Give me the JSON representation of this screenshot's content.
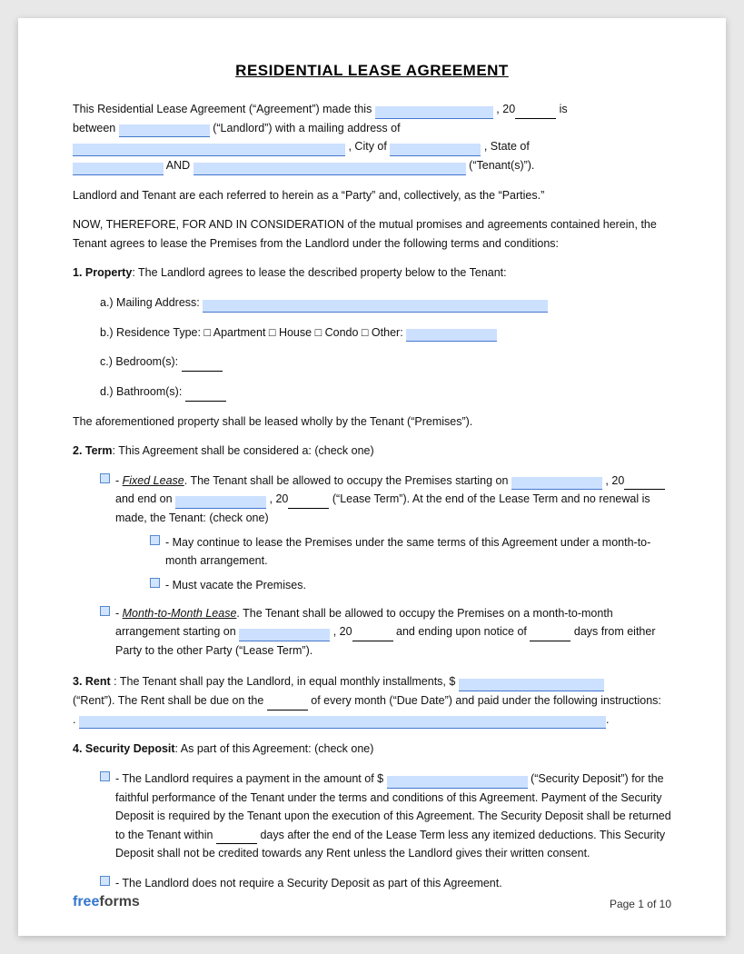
{
  "title": "RESIDENTIAL LEASE AGREEMENT",
  "intro": {
    "line1": "This Residential Lease Agreement (“Agreement”) made this",
    "line1b": ", 20",
    "line1c": "is",
    "line2": "between",
    "line2b": "(“Landlord”) with a mailing address of",
    "line3b": ", City of",
    "line3c": ", State of",
    "line4": "AND",
    "line4b": "(“Tenant(s)”)."
  },
  "parties_note": "Landlord and Tenant are each referred to herein as a “Party” and, collectively, as the “Parties.”",
  "now_therefore": "NOW, THEREFORE, FOR AND IN CONSIDERATION of the mutual promises and agreements contained herein, the Tenant agrees to lease the Premises from the Landlord under the following terms and conditions:",
  "section1": {
    "title": "1. Property",
    "intro": ": The Landlord agrees to lease the described property below to the Tenant:",
    "a_label": "a.)  Mailing Address:",
    "b_label": "b.)  Residence Type:",
    "b_options": [
      "□ Apartment",
      "□ House",
      "□ Condo",
      "□ Other:"
    ],
    "c_label": "c.)  Bedroom(s):",
    "d_label": "d.)  Bathroom(s):",
    "closing": "The aforementioned property shall be leased wholly by the Tenant (“Premises”)."
  },
  "section2": {
    "title": "2. Term",
    "intro": ": This Agreement shall be considered a: (check one)",
    "fixed_label": "- ",
    "fixed_title": "Fixed Lease",
    "fixed_text1": ". The Tenant shall be allowed to occupy the Premises starting on",
    "fixed_text2": ", 20",
    "fixed_text3": "and end on",
    "fixed_text4": ", 20",
    "fixed_text5": "(“Lease Term”). At the end of the Lease Term and no renewal is made, the Tenant: (check one)",
    "sub1": "- May continue to lease the Premises under the same terms of this Agreement under a month-to-month arrangement.",
    "sub2": "- Must vacate the Premises.",
    "mtm_label": "- ",
    "mtm_title": "Month-to-Month Lease",
    "mtm_text1": ". The Tenant shall be allowed to occupy the Premises on a month-to-month arrangement starting on",
    "mtm_text2": ", 20",
    "mtm_text3": "and ending upon notice of",
    "mtm_text4": "days from either Party to the other Party (“Lease Term”)."
  },
  "section3": {
    "title": "3. Rent",
    "text1": ": The Tenant shall pay the Landlord, in equal monthly installments, $",
    "text2": "(“Rent”). The Rent shall be due on the",
    "text3": "of every month (“Due Date”) and paid under the following instructions:",
    "text4": "."
  },
  "section4": {
    "title": "4. Security Deposit",
    "intro": ": As part of this Agreement: (check one)",
    "option1_text": "- The Landlord requires a payment in the amount of $",
    "option1_text2": "(“Security Deposit”) for the faithful performance of the Tenant under the terms and conditions of this Agreement. Payment of the Security Deposit is required by the Tenant upon the execution of this Agreement. The Security Deposit shall be returned to the Tenant within",
    "option1_text3": "days after the end of the Lease Term less any itemized deductions. This Security Deposit shall not be credited towards any Rent unless the Landlord gives their written consent.",
    "option2_text": "- The Landlord does not require a Security Deposit as part of this Agreement."
  },
  "footer": {
    "brand_free": "free",
    "brand_forms": "forms",
    "page_label": "Page 1 of 10"
  }
}
